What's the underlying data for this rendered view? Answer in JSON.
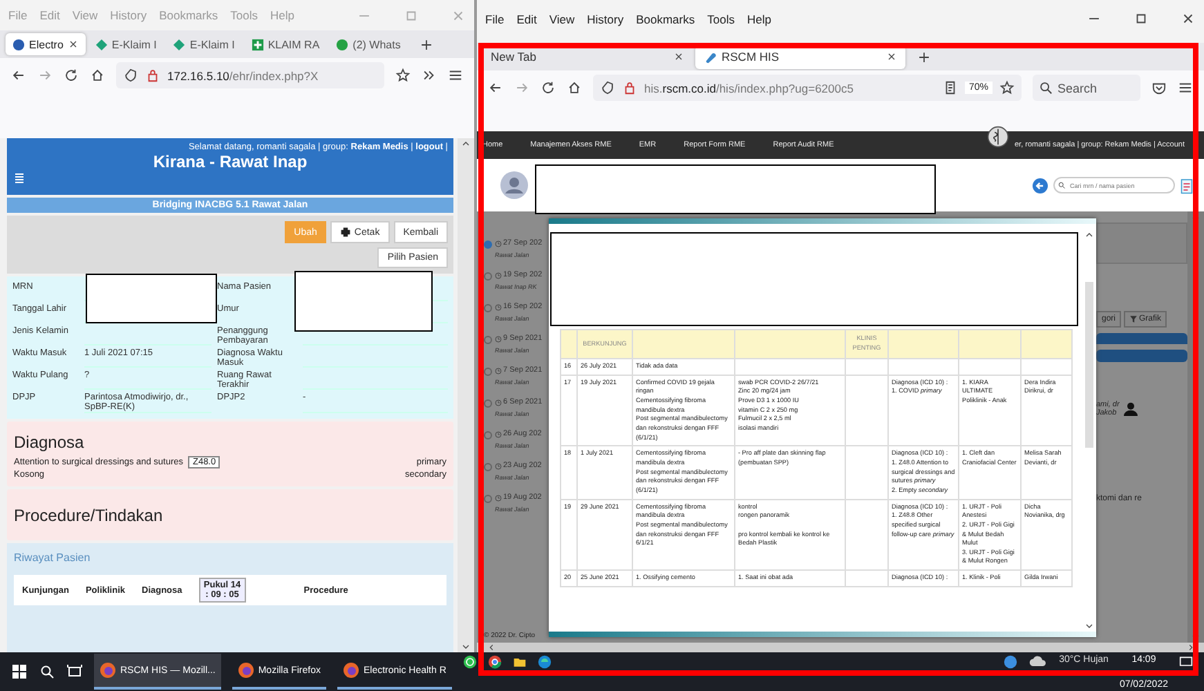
{
  "left_window": {
    "menu": [
      "File",
      "Edit",
      "View",
      "History",
      "Bookmarks",
      "Tools",
      "Help"
    ],
    "tabs": [
      {
        "label": "Electro",
        "selected": true
      },
      {
        "label": "E-Klaim I",
        "selected": false
      },
      {
        "label": "E-Klaim I",
        "selected": false
      },
      {
        "label": "KLAIM RA",
        "selected": false
      },
      {
        "label": "(2) Whats",
        "selected": false
      }
    ],
    "url": "**172.16.5.10**/ehr/index.php?X",
    "page": {
      "greeting": "Selamat datang, romanti sagala | group: **Rekam Medis** | **logout** |",
      "title": "Kirana - Rawat Inap",
      "subtitle": "Bridging INACBG 5.1 Rawat Jalan",
      "buttons": [
        {
          "label": "Ubah",
          "kind": "primary"
        },
        {
          "label": "Cetak",
          "kind": "print"
        },
        {
          "label": "Kembali",
          "kind": "plain"
        }
      ],
      "pick_button": "Pilih Pasien",
      "info_left": [
        {
          "label": "MRN"
        },
        {
          "label": "Tanggal Lahir"
        },
        {
          "label": "Jenis Kelamin"
        },
        {
          "label": "Waktu Masuk",
          "value": "1 Juli 2021 07:15"
        },
        {
          "label": "Waktu Pulang",
          "value": "?"
        },
        {
          "label": "DPJP",
          "value": "Parintosa Atmodiwirjo, dr., SpBP-RE(K)"
        }
      ],
      "info_right": [
        {
          "label": "Nama Pasien"
        },
        {
          "label": "Umur"
        },
        {
          "label": "Penanggung Pembayaran"
        },
        {
          "label": "Diagnosa Waktu Masuk"
        },
        {
          "label": "Ruang Rawat Terakhir"
        },
        {
          "label": "DPJP2",
          "value": "-"
        }
      ],
      "diagnosa": {
        "heading": "Diagnosa",
        "items": [
          {
            "text": "Attention to surgical dressings and sutures",
            "code": "Z48.0",
            "role": "primary"
          },
          {
            "text": "Kosong",
            "role": "secondary"
          }
        ]
      },
      "procedure": {
        "heading": "Procedure/Tindakan"
      },
      "history": {
        "heading": "Riwayat Pasien",
        "columns": [
          "Kunjungan",
          "Poliklinik",
          "Diagnosa"
        ],
        "time_badge": "Pukul 14 : 09 : 05",
        "last_column": "Procedure"
      }
    }
  },
  "right_window": {
    "menu": [
      "File",
      "Edit",
      "View",
      "History",
      "Bookmarks",
      "Tools",
      "Help"
    ],
    "tabs": [
      {
        "label": "New Tab",
        "selected": false
      },
      {
        "label": "RSCM HIS",
        "selected": true
      }
    ],
    "url": "his.**rscm.co.id**/his/index.php?ug=6200c5",
    "zoom": "70%",
    "search_placeholder": "Search",
    "nav": [
      "Home",
      "Manajemen Akses RME",
      "EMR",
      "Report Form RME",
      "Report Audit RME"
    ],
    "nav_user": "er, romanti sagala | group: Rekam Medis | Account",
    "patient_search_placeholder": "Cari mrn / nama pasien",
    "timeline": [
      {
        "date": "27 Sep 202",
        "type": "Rawat Jalan",
        "selected": true
      },
      {
        "date": "19 Sep 202",
        "type": "Rawat Inap RK",
        "selected": false
      },
      {
        "date": "16 Sep 202",
        "type": "Rawat Jalan",
        "selected": false
      },
      {
        "date": "9 Sep 2021",
        "type": "Rawat Jalan",
        "selected": false
      },
      {
        "date": "7 Sep 2021",
        "type": "Rawat Jalan",
        "selected": false
      },
      {
        "date": "6 Sep 2021",
        "type": "Rawat Jalan",
        "selected": false
      },
      {
        "date": "26 Aug 202",
        "type": "Rawat Jalan",
        "selected": false
      },
      {
        "date": "23 Aug 202",
        "type": "Rawat Jalan",
        "selected": false
      },
      {
        "date": "19 Aug 202",
        "type": "Rawat Jalan",
        "selected": false
      }
    ],
    "footer": "© 2022 Dr. Cipto",
    "behind": {
      "category_button": "gori",
      "chart_button": "Grafik",
      "doctor_name": "ami, dr",
      "doctor_unit": "Jakob",
      "procedure_text": "ktomi dan re"
    },
    "modal": {
      "columns": [
        "",
        "BERKUNJUNG",
        "",
        "",
        "KLINIS PENTING",
        "",
        "",
        ""
      ],
      "rows": [
        {
          "no": "16",
          "date": "26 July 2021",
          "diagnosis": "Tidak ada data"
        },
        {
          "no": "17",
          "date": "19 July 2021",
          "diagnosis": "Confirmed COVID 19 gejala ringan\nCementossifying fibroma mandibula dextra\nPost segmental mandibulectomy dan rekonstruksi dengan FFF (6/1/21)",
          "therapy": "swab PCR COVID-2 26/7/21\nZinc 20 mg/24 jam\nProve D3 1 x 1000 IU\nvitamin C 2 x 250 mg\nFulmucil 2 x 2,5 ml\nisolasi mandiri",
          "icd": "Diagnosa (ICD 10) :\n1. COVID *primary*",
          "clinic": "1. KIARA ULTIMATE Poliklinik - Anak",
          "doctor": "Dera Indira Dirikrui, dr"
        },
        {
          "no": "18",
          "date": "1 July 2021",
          "diagnosis": "Cementossifying fibroma mandibula dextra\nPost segmental mandibulectomy dan rekonstruksi dengan FFF (6/1/21)",
          "therapy": "- Pro aff plate dan skinning flap (pembuatan SPP)",
          "icd": "Diagnosa (ICD 10) :\n1. Z48.0 Attention to surgical dressings and sutures *primary*\n2. Empty *secondary*",
          "clinic": "1. Cleft dan Craniofacial Center",
          "doctor": "Melisa Sarah Devianti, dr"
        },
        {
          "no": "19",
          "date": "29 June 2021",
          "diagnosis": "Cementossifying fibroma mandibula dextra\nPost segmental mandibulectomy dan rekonstruksi dengan FFF 6/1/21",
          "therapy": "kontrol\nrongen panoramik\n\npro kontrol kembali ke kontrol ke Bedah Plastik",
          "icd": "Diagnosa (ICD 10) :\n1. Z48.8 Other specified surgical follow-up care *primary*",
          "clinic": "1. URJT - Poli Anestesi\n2. URJT - Poli Gigi & Mulut Bedah Mulut\n3. URJT - Poli Gigi & Mulut Rongen",
          "doctor": "Dicha Novianika, drg"
        },
        {
          "no": "20",
          "date": "25 June 2021",
          "diagnosis": "1. Ossifying cemento",
          "therapy": "1. Saat ini obat ada",
          "icd": "Diagnosa (ICD 10) :",
          "clinic": "1. Klinik - Poli",
          "doctor": "Gilda Irwani"
        }
      ]
    }
  },
  "taskbar": {
    "apps": [
      {
        "label": "RSCM HIS — Mozill...",
        "selected": true
      },
      {
        "label": "Mozilla Firefox",
        "selected": false
      },
      {
        "label": "Electronic Health R",
        "selected": false
      }
    ],
    "weather": "30°C Hujan",
    "time": "14:09",
    "date": "07/02/2022"
  }
}
